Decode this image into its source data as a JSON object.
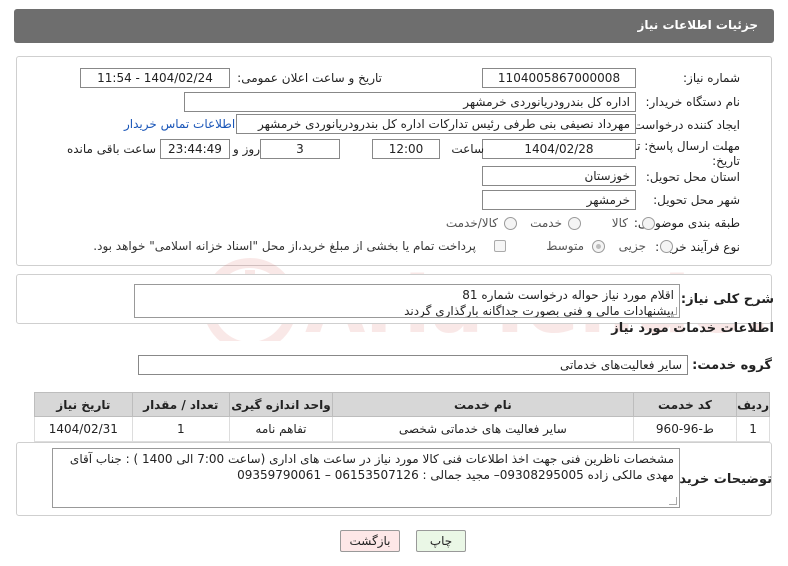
{
  "header": {
    "title": "جزئیات اطلاعات نیاز"
  },
  "form": {
    "need_number_label": "شماره نیاز:",
    "need_number": "1104005867000008",
    "announce_label": "تاریخ و ساعت اعلان عمومی:",
    "announce_value": "1404/02/24 - 11:54",
    "buyer_label": "نام دستگاه خریدار:",
    "buyer_value": "اداره کل بندرودریانوردی خرمشهر",
    "creator_label": "ایجاد کننده درخواست:",
    "creator_value": "مهرداد  نصیفی بنی طرفی رئیس تدارکات اداره کل بندرودریانوردی خرمشهر",
    "contact_link": "اطلاعات تماس خریدار",
    "deadline_label": "مهلت ارسال پاسخ: تا تاریخ:",
    "deadline_date": "1404/02/28",
    "time_label": "ساعت",
    "deadline_time": "12:00",
    "days_value": "3",
    "days_label": "روز و",
    "remaining_time": "23:44:49",
    "remaining_label": "ساعت باقی مانده",
    "province_label": "استان محل تحویل:",
    "province_value": "خوزستان",
    "city_label": "شهر محل تحویل:",
    "city_value": "خرمشهر",
    "category_label": "طبقه بندی موضوعی:",
    "category_options": [
      "کالا",
      "خدمت",
      "کالا/خدمت"
    ],
    "process_label": "نوع فرآیند خرید :",
    "process_options": [
      "جزیی",
      "متوسط"
    ],
    "payment_note": "پرداخت تمام یا بخشی از مبلغ خرید،از محل \"اسناد خزانه اسلامی\" خواهد بود."
  },
  "summary": {
    "label": "شرح کلی نیاز:",
    "line1": "اقلام مورد نیاز حواله درخواست شماره 81",
    "line2": "پیشنهادات مالی و فنی بصورت جداگانه بارگذاری گردند"
  },
  "services": {
    "section_title": "اطلاعات خدمات مورد نیاز",
    "group_label": "گروه خدمت:",
    "group_value": "سایر فعالیت‌های خدماتی",
    "columns": [
      "ردیف",
      "کد خدمت",
      "نام خدمت",
      "واحد اندازه گیری",
      "تعداد / مقدار",
      "تاریخ نیاز"
    ],
    "rows": [
      [
        "1",
        "ط-96-960",
        "سایر فعالیت های خدماتی شخصی",
        "تفاهم نامه",
        "1",
        "1404/02/31"
      ]
    ]
  },
  "notes": {
    "label": "توضیحات خریدار:",
    "line1": "مشخصات ناظرین فنی جهت اخذ اطلاعات فنی کالا مورد نیاز در ساعت های اداری (ساعت 7:00 الی 1400 ) : جناب آقای",
    "line2": "مهدی مالکی زاده 09308295005– مجید جمالی : 06153507126 – 09359790061"
  },
  "buttons": {
    "print": "چاپ",
    "back": "بازگشت"
  },
  "watermark": {
    "text": "AriaTender.neT"
  },
  "colors": {
    "header_bg": "#6e6e6e",
    "link": "#1a56b8",
    "back_btn_bg": "#fde7e7",
    "print_btn_bg": "#eaf7e6",
    "watermark": "#d9534f"
  }
}
